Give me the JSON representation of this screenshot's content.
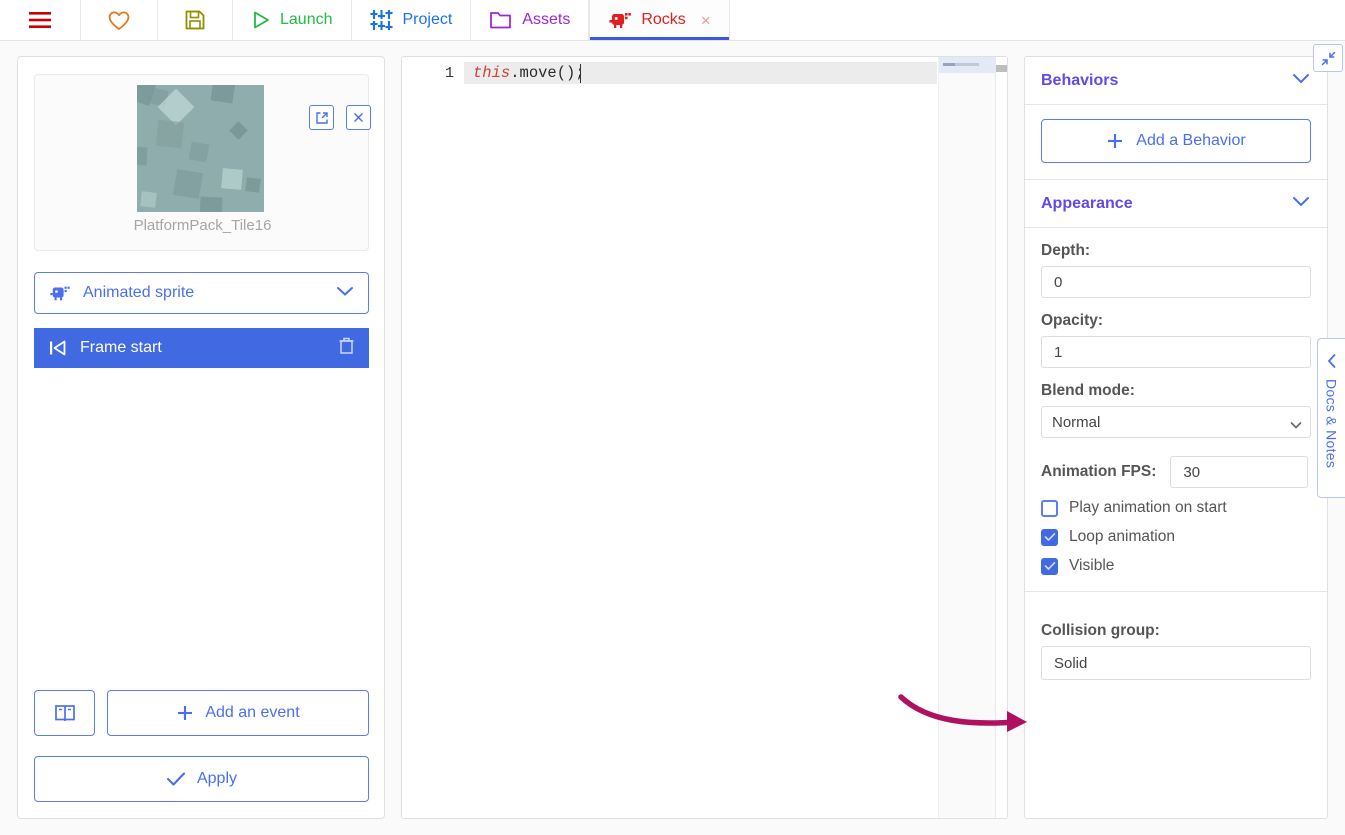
{
  "toolbar": {
    "items": [
      {
        "name": "menu",
        "icon": "hamburger-menu-icon",
        "label": "",
        "color": "#cc0000"
      },
      {
        "name": "favorite",
        "icon": "heart-icon",
        "label": "",
        "color": "#e07b1f"
      },
      {
        "name": "save",
        "icon": "floppy-save-icon",
        "label": "",
        "color": "#8f8f00"
      },
      {
        "name": "launch",
        "icon": "play-triangle-icon",
        "label": "Launch",
        "color": "#22bb44"
      },
      {
        "name": "project",
        "icon": "sliders-icon",
        "label": "Project",
        "color": "#1a73e8"
      },
      {
        "name": "assets",
        "icon": "folder-icon",
        "label": "Assets",
        "color": "#9c27d8"
      },
      {
        "name": "rocks",
        "icon": "sprite-object-icon",
        "label": "Rocks",
        "color": "#e02020",
        "active": true,
        "close": "×"
      }
    ]
  },
  "left_panel": {
    "sprite": {
      "name": "PlatformPack_Tile16",
      "base_color": "#8fadac",
      "open_icon": "external-link-icon",
      "close_icon": "close-x-icon"
    },
    "object_type": {
      "label": "Animated sprite",
      "icon": "sprite-object-icon",
      "chevron": "chevron-down-icon"
    },
    "event": {
      "label": "Frame start",
      "icon": "skip-back-icon",
      "delete_icon": "trash-icon",
      "highlight_color": "#4169e1"
    },
    "buttons": {
      "docs_icon": "book-icon",
      "add_event_label": "Add an event",
      "add_event_icon": "plus-icon",
      "apply_label": "Apply",
      "apply_icon": "check-icon"
    }
  },
  "editor": {
    "line_number": "1",
    "code_keyword": "this",
    "code_rest": ".move();"
  },
  "right_panel": {
    "behaviors": {
      "title": "Behaviors",
      "chevron": "chevron-down-icon",
      "add_label": "Add a Behavior",
      "add_icon": "plus-icon"
    },
    "appearance": {
      "title": "Appearance",
      "chevron": "chevron-down-icon",
      "depth_label": "Depth:",
      "depth_value": "0",
      "opacity_label": "Opacity:",
      "opacity_value": "1",
      "blend_label": "Blend mode:",
      "blend_value": "Normal",
      "blend_options": [
        "Normal"
      ],
      "fps_label": "Animation FPS:",
      "fps_value": "30",
      "checkboxes": [
        {
          "label": "Play animation on start",
          "checked": false
        },
        {
          "label": "Loop animation",
          "checked": true
        },
        {
          "label": "Visible",
          "checked": true
        }
      ]
    },
    "collision": {
      "label": "Collision group:",
      "value": "Solid"
    }
  },
  "docs_tab": {
    "label": "Docs & Notes",
    "chevron": "chevron-left-icon"
  },
  "collapse": {
    "icon": "collapse-diagonal-icon"
  },
  "annotation": {
    "type": "curved-arrow",
    "color": "#b01060",
    "points_to": "collision-group-input"
  }
}
